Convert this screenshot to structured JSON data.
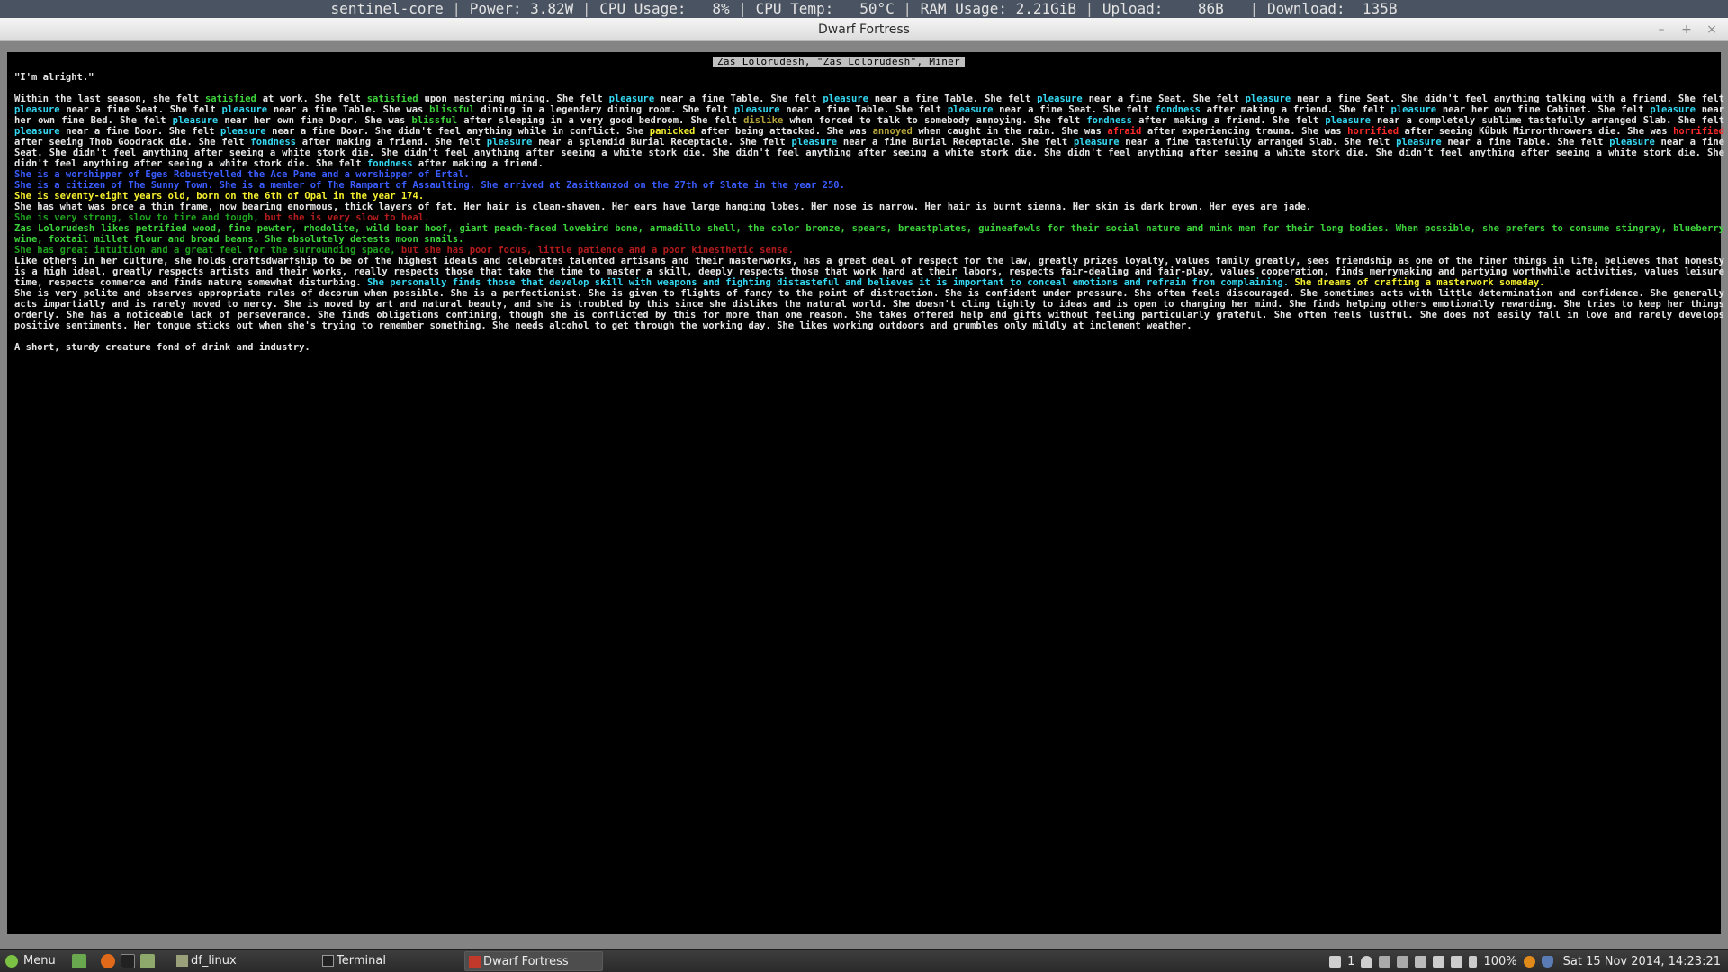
{
  "status_bar": {
    "host": "sentinel-core",
    "power": "Power: 3.82W",
    "cpu_usage": "CPU Usage:   8%",
    "cpu_temp": "CPU Temp:   50°C",
    "ram": "RAM Usage: 2.21GiB",
    "upload": "Upload:    86B",
    "download": "Download:  135B"
  },
  "window": {
    "title": "Dwarf Fortress",
    "controls": [
      "–",
      "+",
      "×"
    ]
  },
  "game": {
    "header": "Zas Lolorudesh, \"Zas Lolorudesh\", Miner",
    "quote": "\"I'm alright.\"",
    "thoughts": [
      {
        "t": "Within the last season,  she felt "
      },
      {
        "t": "satisfied",
        "c": "g"
      },
      {
        "t": " at work. She felt  "
      },
      {
        "t": "satisfied",
        "c": "g"
      },
      {
        "t": " upon mastering mining. She felt "
      },
      {
        "t": "pleasure",
        "c": "c"
      },
      {
        "t": " near a fine Table. She felt "
      },
      {
        "t": "pleasure",
        "c": "c"
      },
      {
        "t": " near a fine Table. She felt "
      },
      {
        "t": "pleasure",
        "c": "c"
      },
      {
        "t": "  near a fine Seat. She felt "
      },
      {
        "t": "pleasure",
        "c": "c"
      },
      {
        "t": " near a fine Seat. She didn't feel  anything talking with a friend. She felt  "
      },
      {
        "t": "pleasure",
        "c": "c"
      },
      {
        "t": " near a fine Seat. She felt "
      },
      {
        "t": "pleasure",
        "c": "c"
      },
      {
        "t": " near a fine Table. She was "
      },
      {
        "t": "blissful",
        "c": "g"
      },
      {
        "t": " dining in a legendary dining room.  She felt "
      },
      {
        "t": "pleasure",
        "c": "c"
      },
      {
        "t": " near a fine Table. She felt "
      },
      {
        "t": "pleasure",
        "c": "c"
      },
      {
        "t": " near a fine Seat.  She felt "
      },
      {
        "t": "fondness",
        "c": "c"
      },
      {
        "t": " after making a friend.  She felt "
      },
      {
        "t": "pleasure",
        "c": "c"
      },
      {
        "t": " near her own fine Cabinet. She felt "
      },
      {
        "t": "pleasure",
        "c": "c"
      },
      {
        "t": " near her own fine Bed. She felt "
      },
      {
        "t": "pleasure",
        "c": "c"
      },
      {
        "t": " near her own fine  Door. She was "
      },
      {
        "t": "blissful",
        "c": "g"
      },
      {
        "t": " after sleeping in a very good bedroom. She felt "
      },
      {
        "t": "dislike",
        "c": "o"
      },
      {
        "t": "  when forced to talk to somebody  annoying. She felt "
      },
      {
        "t": "fondness",
        "c": "c"
      },
      {
        "t": " after making a friend. She felt "
      },
      {
        "t": "pleasure",
        "c": "c"
      },
      {
        "t": " near  a completely sublime tastefully arranged Slab. She  felt "
      },
      {
        "t": "pleasure",
        "c": "c"
      },
      {
        "t": " near a fine Door. She felt "
      },
      {
        "t": "pleasure",
        "c": "c"
      },
      {
        "t": " near a fine Door. She didn't feel anything while in conflict. She "
      },
      {
        "t": "panicked",
        "c": "y"
      },
      {
        "t": " after being attacked. She was "
      },
      {
        "t": "annoyed",
        "c": "o"
      },
      {
        "t": " when caught in the rain. She was "
      },
      {
        "t": "afraid",
        "c": "r"
      },
      {
        "t": " after experiencing trauma. She was "
      },
      {
        "t": "horrified",
        "c": "r"
      },
      {
        "t": " after seeing Kûbuk Mirrorthrowers die. She was "
      },
      {
        "t": "horrified",
        "c": "r"
      },
      {
        "t": " after  seeing Thob Goodrack die. She felt  "
      },
      {
        "t": "fondness",
        "c": "c"
      },
      {
        "t": " after making a friend. She felt "
      },
      {
        "t": "pleasure",
        "c": "c"
      },
      {
        "t": " near a splendid Burial Receptacle. She felt "
      },
      {
        "t": "pleasure",
        "c": "c"
      },
      {
        "t": " near a fine  Burial Receptacle. She felt "
      },
      {
        "t": "pleasure",
        "c": "c"
      },
      {
        "t": " near a fine tastefully arranged Slab. She felt  "
      },
      {
        "t": "pleasure",
        "c": "c"
      },
      {
        "t": " near a fine Table. She  felt "
      },
      {
        "t": "pleasure",
        "c": "c"
      },
      {
        "t": " near a fine Seat. She didn't feel anything after seeing a  white stork die. She didn't feel anything after  seeing a white stork die. She didn't feel anything after seeing a white stork die. She didn't feel anything after seeing a white stork die. She didn't feel anything after seeing a white stork die. She didn't feel anything after seeing a white stork die. She felt "
      },
      {
        "t": "fondness",
        "c": "c"
      },
      {
        "t": " after making a friend."
      }
    ],
    "worship": "She is a worshipper of Eges Robustyelled the Ace Pane and a worshipper of Ertal.",
    "citizen": "She is a citizen of The Sunny Town. She is a member of The Rampart of Assaulting. She arrived at Zasitkanzod on the 27th of Slate in the year 250.",
    "age": "She is seventy-eight years old, born on the 6th of Opal in the year 174.",
    "appearance": "She has what was once a thin frame, now bearing enormous, thick layers of fat. Her hair is clean-shaven. Her ears have large hanging lobes. Her nose is narrow. Her hair is burnt sienna. Her skin is dark brown. Her eyes are jade.",
    "physical": [
      {
        "t": "She is very strong, slow to tire and tough, ",
        "c": "gr"
      },
      {
        "t": "but she is very slow to heal.",
        "c": "dr"
      }
    ],
    "likes": "Zas Lolorudesh likes  petrified wood, fine pewter, rhodolite,  wild boar hoof, giant peach-faced  lovebird bone, armadillo shell, the color  bronze, spears, breastplates, guineafowls for their  social nature and mink men  for their long bodies. When possible, she prefers to consume stingray, blueberry wine, foxtail millet flour and broad beans. She absolutely detests moon snails.",
    "mental": [
      {
        "t": "She has great intuition and a great feel for the surrounding space, ",
        "c": "gr"
      },
      {
        "t": "but she has poor focus, little patience and a poor kinesthetic sense.",
        "c": "dr"
      }
    ],
    "values": [
      {
        "t": "Like others in her  culture, she holds craftsdwarfship  to  be of the highest ideals and celebrates talented artisans and their masterworks,  has a great deal of respect for  the law, greatly prizes loyalty, values  family greatly, sees friendship as one of  the finer things in life, believes  that honesty is a high ideal, greatly respects artists and their works, really respects those that take the time to master  a skill, deeply respects those that work hard at their labors, respects fair-dealing and fair-play, values cooperation, finds merrymaking and partying worthwhile activities, values leisure time, respects commerce and finds nature somewhat  disturbing. ",
        "c": "w"
      },
      {
        "t": "She personally finds those that develop skill with weapons and fighting distasteful and believes it is important to conceal emotions and refrain from complaining.",
        "c": "c"
      },
      {
        "t": " She dreams of crafting a masterwork someday.",
        "c": "y"
      }
    ],
    "personality": "She is very polite  and observes appropriate rules of  decorum  when possible.  She is a  perfectionist. She is given to flights of  fancy to the point of distraction. She  is confident under pressure. She  often  feels discouraged. She sometimes acts with little determination and confidence. She generally acts impartially and is rarely moved to mercy. She is moved by art and natural beauty, and she is troubled by  this since she dislikes the natural world. She doesn't cling tightly to ideas  and is open to changing her  mind. She finds helping others emotionally rewarding. She tries to keep her  things orderly. She has a noticeable lack  of perseverance. She finds obligations confining, though she is conflicted by this for  more than one reason. She  takes offered help and gifts without feeling particularly grateful. She often feels lustful. She does not easily fall in  love and rarely develops positive sentiments. Her tongue sticks out when she's trying to remember something. She needs alcohol to get through the working day. She likes working outdoors and grumbles only mildly at inclement weather.",
    "description": "A short, sturdy creature fond of drink and industry."
  },
  "taskbar": {
    "menu_label": "Menu",
    "windows": [
      {
        "label": "df_linux",
        "icon": "folder-icon"
      },
      {
        "label": "Terminal",
        "icon": "terminal-icon"
      },
      {
        "label": "Dwarf Fortress",
        "icon": "dwarf-fortress-icon"
      }
    ],
    "tray": {
      "notification_count": "1",
      "battery": "100%",
      "datetime": "Sat 15 Nov 2014, 14:23:21"
    }
  },
  "colors": {
    "green": "#3cd33c",
    "cyan": "#34d8f2",
    "yellow": "#f3ee2e",
    "red": "#ff2a2a",
    "blue": "#3a5cff"
  }
}
